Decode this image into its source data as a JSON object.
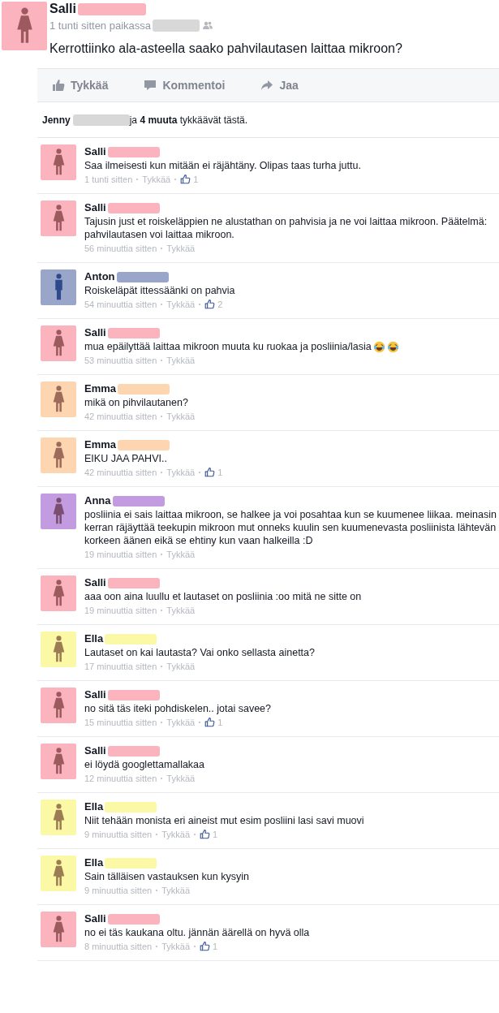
{
  "post": {
    "author": "Salli",
    "avatar": {
      "kind": "female",
      "color": "#fbb3bd"
    },
    "name_bar": {
      "color": "#fbb3bd"
    },
    "time": "1 tunti sitten paikassa",
    "place_bar": {
      "color": "#d8d8d8"
    },
    "text": "Kerrottiinko ala-asteella saako pahvilautasen laittaa mikroon?"
  },
  "actions": [
    {
      "kind": "like",
      "label": "Tykkää"
    },
    {
      "kind": "comment",
      "label": "Kommentoi"
    },
    {
      "kind": "share",
      "label": "Jaa"
    }
  ],
  "likes": {
    "name": "Jenny",
    "bar": {
      "color": "#d8d8d8"
    },
    "text": "ja **4 muuta** tykkäävät tästä."
  },
  "comments": [
    {
      "author": "Salli",
      "kind": "female",
      "color": "#fbb3bd",
      "text": "Saa ilmeisesti kun mitään ei räjähtäny. Olipas taas turha juttu.",
      "time": "1 tunti sitten",
      "like_label": "Tykkää",
      "likes": "1"
    },
    {
      "author": "Salli",
      "kind": "female",
      "color": "#fbb3bd",
      "text": "Tajusin just et roiskeläppien ne alustathan on pahvisia ja ne voi laittaa mikroon. Päätelmä: pahvilautasen voi laittaa mikroon.",
      "time": "56 minuuttia sitten",
      "like_label": "Tykkää"
    },
    {
      "author": "Anton",
      "kind": "male",
      "color": "#9aa6c9",
      "text": "Roiskeläpät ittessäänki on pahvia",
      "time": "54 minuuttia sitten",
      "like_label": "Tykkää",
      "likes": "2"
    },
    {
      "author": "Salli",
      "kind": "female",
      "color": "#fbb3bd",
      "text": "mua epäilyttää laittaa mikroon muuta ku ruokaa ja posliinia/lasia",
      "emojis": [
        {
          "kind": "laughing"
        },
        {
          "kind": "laughing"
        }
      ],
      "time": "53 minuuttia sitten",
      "like_label": "Tykkää"
    },
    {
      "author": "Emma",
      "kind": "female",
      "color": "#fdd5b1",
      "text": "mikä on pihvilautanen?",
      "time": "42 minuuttia sitten",
      "like_label": "Tykkää"
    },
    {
      "author": "Emma",
      "kind": "female",
      "color": "#fdd5b1",
      "text": "EIKU JAA PAHVI..",
      "time": "42 minuuttia sitten",
      "like_label": "Tykkää",
      "likes": "1"
    },
    {
      "author": "Anna",
      "kind": "female",
      "color": "#c39be0",
      "text": "posliinia ei sais laittaa mikroon, se halkee ja voi posahtaa kun se kuumenee liikaa. meinasin kerran räjäyttää teekupin mikroon mut onneks kuulin sen kuumenevasta posliinista lähtevän korkeen äänen eikä se ehtiny kun vaan halkeilla :D",
      "time": "19 minuuttia sitten",
      "like_label": "Tykkää"
    },
    {
      "author": "Salli",
      "kind": "female",
      "color": "#fbb3bd",
      "text": "aaa oon aina luullu et lautaset on posliinia :oo mitä ne sitte on",
      "time": "19 minuuttia sitten",
      "like_label": "Tykkää"
    },
    {
      "author": "Ella",
      "kind": "female",
      "color": "#fbf9a6",
      "text": "Lautaset on kai lautasta? Vai onko sellasta ainetta?",
      "time": "17 minuuttia sitten",
      "like_label": "Tykkää"
    },
    {
      "author": "Salli",
      "kind": "female",
      "color": "#fbb3bd",
      "text": "no sitä täs iteki pohdiskelen.. jotai savee?",
      "time": "15 minuuttia sitten",
      "like_label": "Tykkää",
      "likes": "1"
    },
    {
      "author": "Salli",
      "kind": "female",
      "color": "#fbb3bd",
      "text": "ei löydä googlettamallakaa",
      "time": "12 minuuttia sitten",
      "like_label": "Tykkää"
    },
    {
      "author": "Ella",
      "kind": "female",
      "color": "#fbf9a6",
      "text": "Niit tehään monista eri aineist mut esim posliini lasi savi muovi",
      "time": "9 minuuttia sitten",
      "like_label": "Tykkää",
      "likes": "1"
    },
    {
      "author": "Ella",
      "kind": "female",
      "color": "#fbf9a6",
      "text": "Sain tälläisen vastauksen kun kysyin",
      "time": "9 minuuttia sitten",
      "like_label": "Tykkää"
    },
    {
      "author": "Salli",
      "kind": "female",
      "color": "#fbb3bd",
      "text": "no ei täs kaukana oltu. jännän äärellä on hyvä olla",
      "time": "8 minuuttia sitten",
      "like_label": "Tykkää",
      "likes": "1"
    }
  ]
}
